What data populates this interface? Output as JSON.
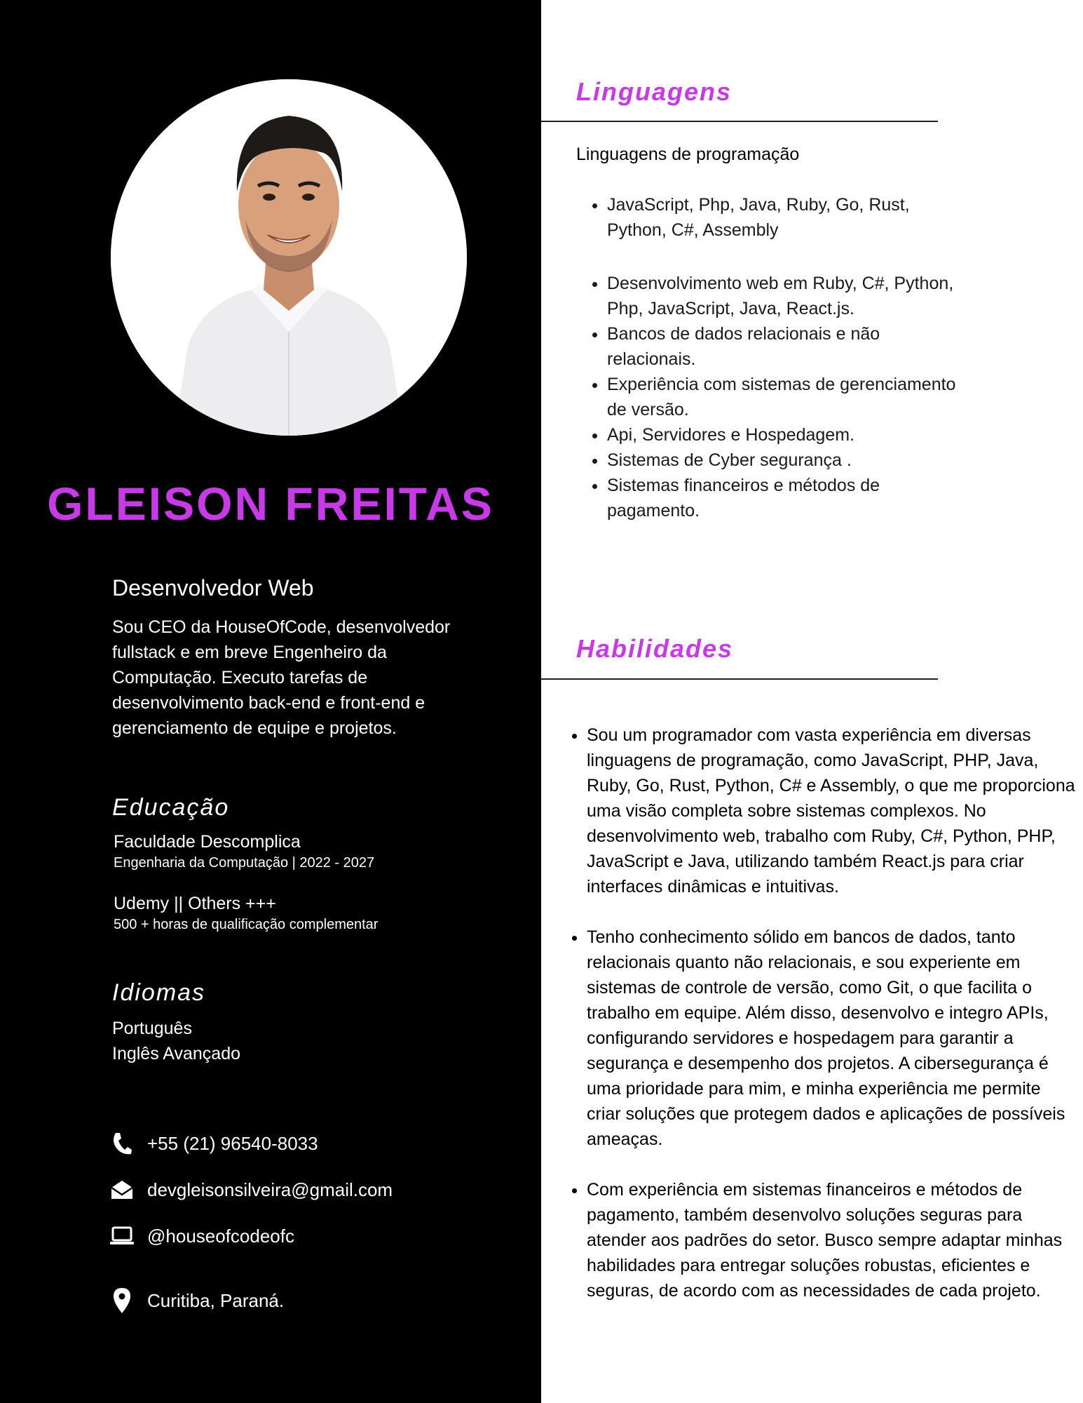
{
  "colors": {
    "accent": "#c83ae8",
    "left_bg": "#000000",
    "right_bg": "#ffffff"
  },
  "profile": {
    "name": "GLEISON FREITAS",
    "role": "Desenvolvedor Web",
    "bio": "Sou CEO da HouseOfCode, desenvolvedor fullstack e em breve Engenheiro da Computação. Executo tarefas de desenvolvimento back-end e front-end e gerenciamento de equipe e projetos."
  },
  "education": {
    "heading": "Educação",
    "items": [
      {
        "title": "Faculdade Descomplica",
        "subtitle": "Engenharia da Computação | 2022 - 2027"
      },
      {
        "title": "Udemy || Others +++",
        "subtitle": "500 + horas de qualificação complementar"
      }
    ]
  },
  "languages_spoken": {
    "heading": "Idiomas",
    "items": [
      "Português",
      "Inglês Avançado"
    ]
  },
  "contact": [
    {
      "icon": "phone-icon",
      "text": "+55 (21) 96540-8033"
    },
    {
      "icon": "email-icon",
      "text": "devgleisonsilveira@gmail.com"
    },
    {
      "icon": "laptop-icon",
      "text": "@houseofcodeofc"
    },
    {
      "icon": "location-pin-icon",
      "text": "Curitiba, Paraná."
    }
  ],
  "programming": {
    "heading": "Linguagens",
    "intro": "Linguagens de programação",
    "group1": [
      "JavaScript, Php, Java, Ruby, Go, Rust, Python, C#, Assembly"
    ],
    "group2": [
      "Desenvolvimento web em Ruby, C#, Python, Php, JavaScript, Java, React.js.",
      "Bancos de dados relacionais e não relacionais.",
      "Experiência com sistemas de gerenciamento de versão.",
      "Api, Servidores e Hospedagem.",
      "Sistemas de  Cyber segurança .",
      "Sistemas financeiros e métodos de pagamento."
    ]
  },
  "skills": {
    "heading": "Habilidades",
    "items": [
      "Sou um programador com vasta experiência em diversas linguagens de programação, como JavaScript, PHP, Java, Ruby, Go, Rust, Python, C# e Assembly, o que me proporciona uma visão completa sobre sistemas complexos. No desenvolvimento web, trabalho com Ruby, C#, Python, PHP, JavaScript e Java, utilizando também React.js para criar interfaces dinâmicas e intuitivas.",
      "Tenho conhecimento sólido em bancos de dados, tanto relacionais quanto não relacionais, e sou experiente em sistemas de controle de versão, como Git, o que facilita o trabalho em equipe. Além disso, desenvolvo e integro APIs, configurando servidores e hospedagem para garantir a segurança e desempenho dos projetos. A cibersegurança é uma prioridade para mim, e minha experiência me permite criar soluções que protegem dados e aplicações de possíveis ameaças.",
      "Com experiência em sistemas financeiros e métodos de pagamento, também desenvolvo soluções seguras para atender aos padrões do setor. Busco sempre adaptar minhas habilidades para entregar soluções robustas, eficientes e seguras, de acordo com as necessidades de cada projeto."
    ]
  }
}
